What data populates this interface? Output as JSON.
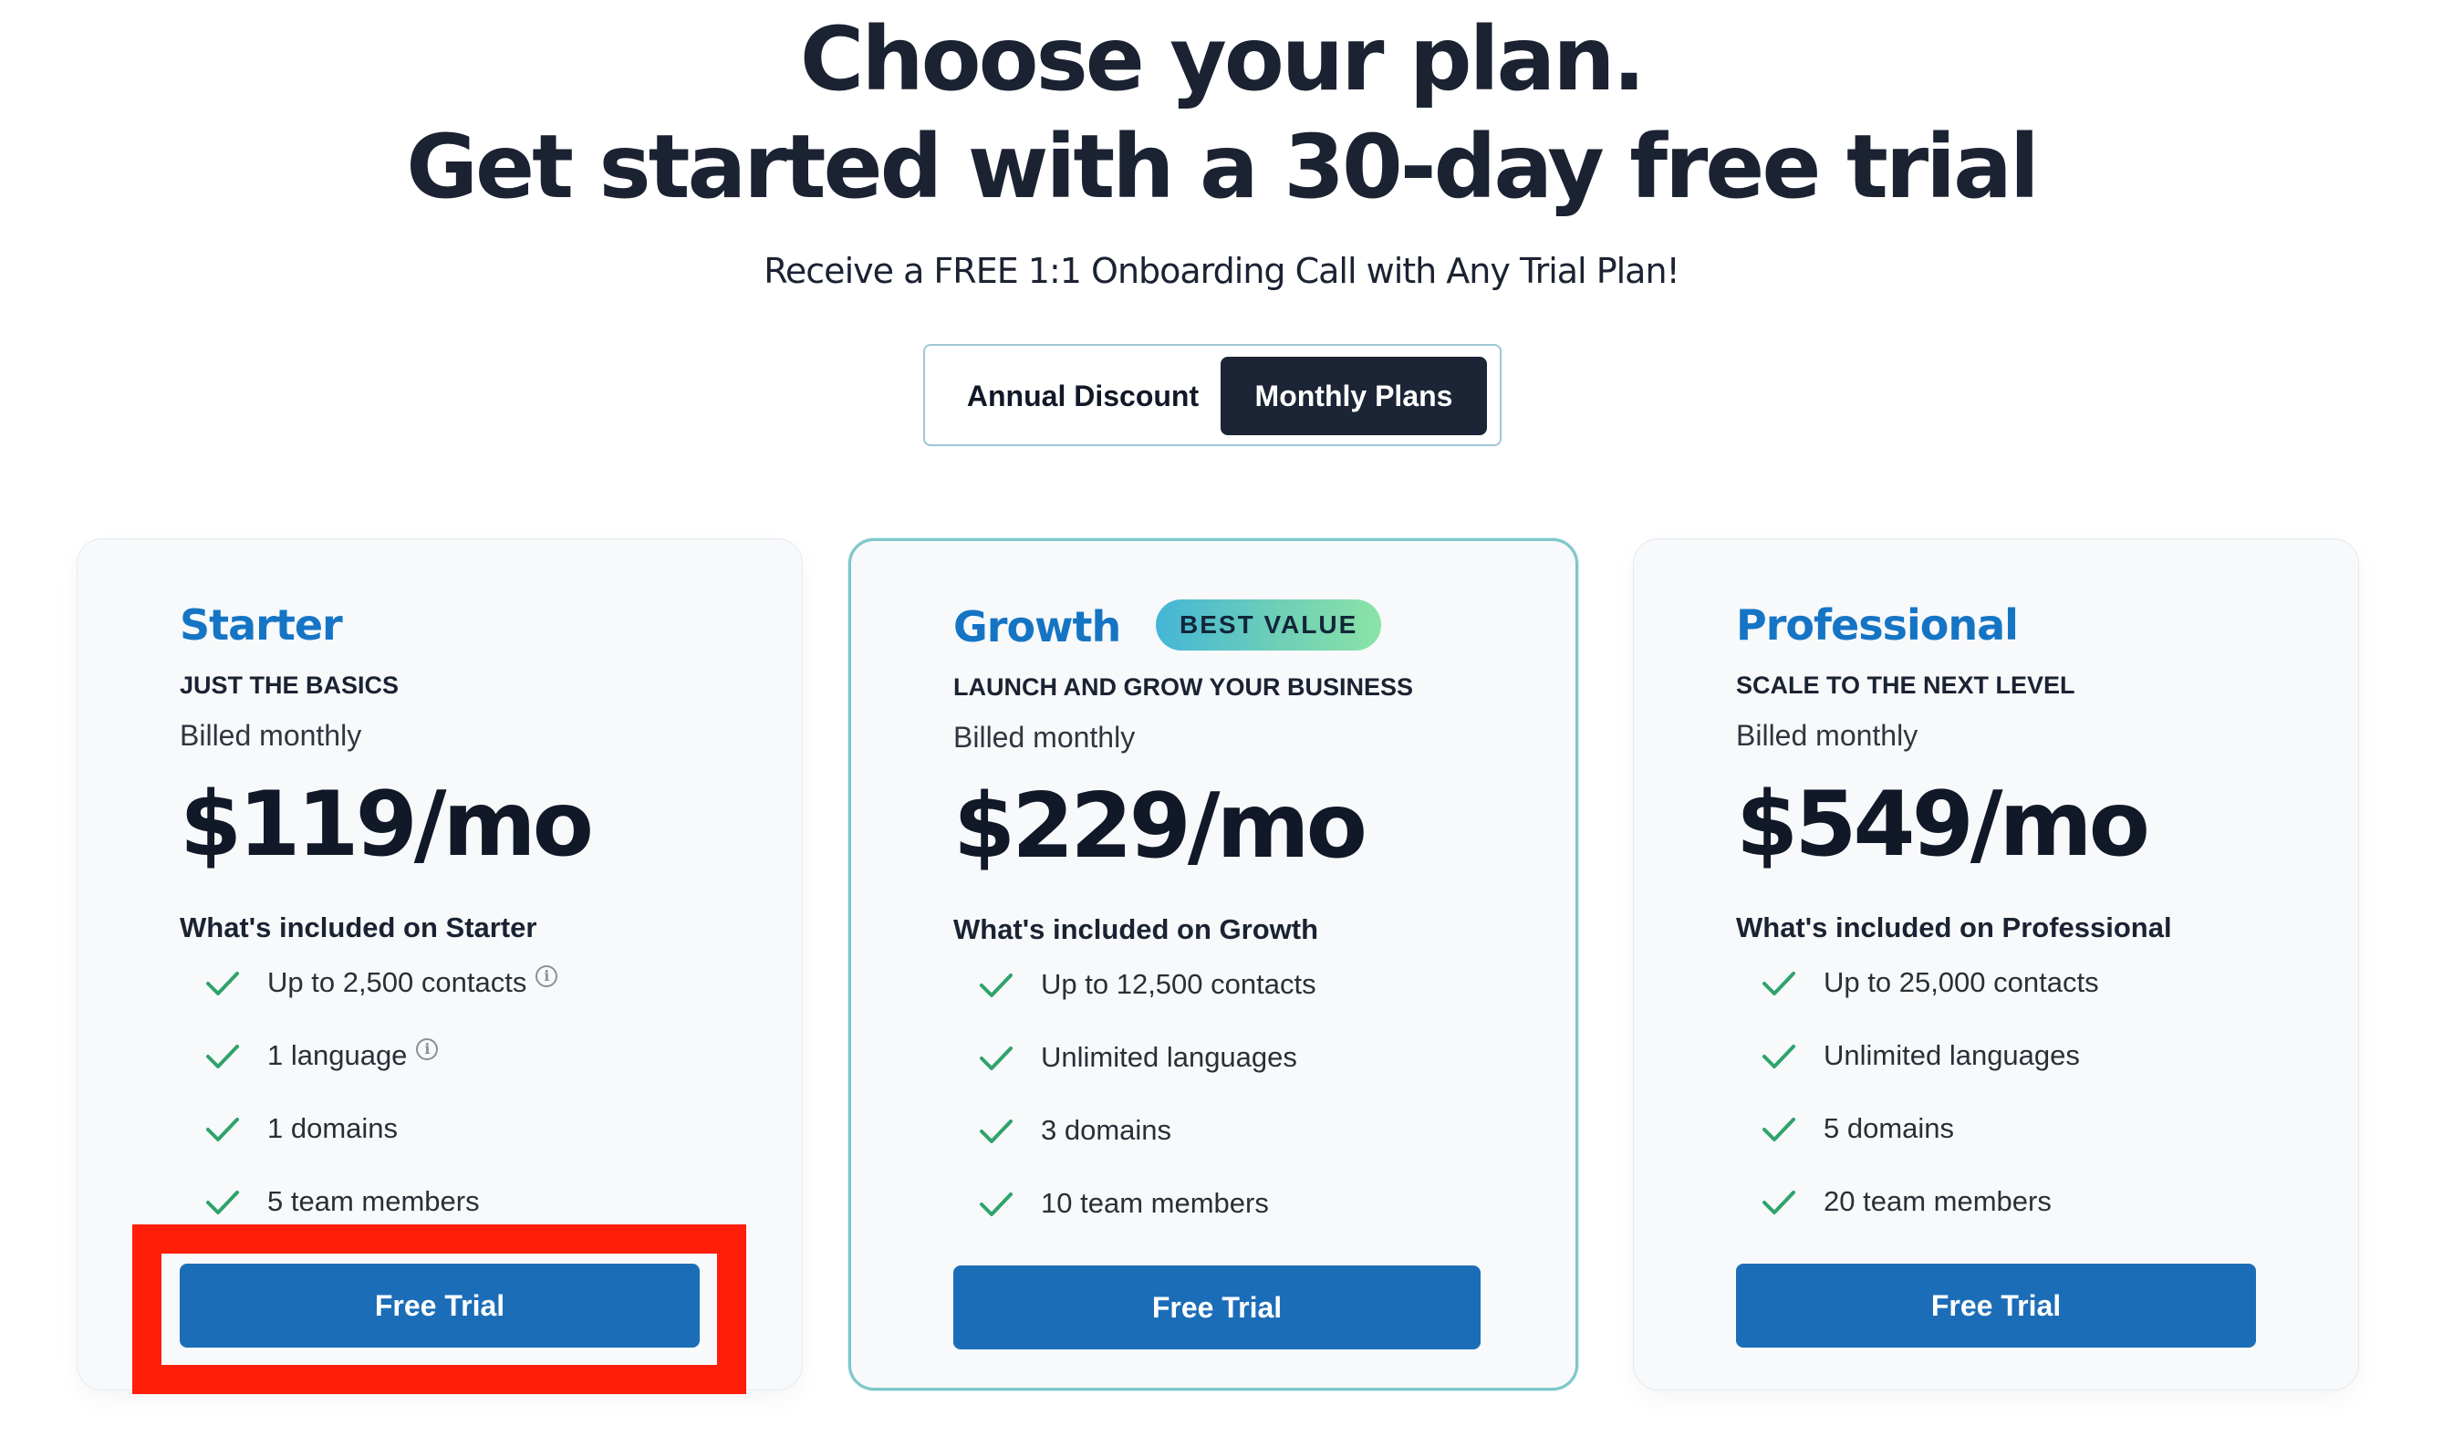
{
  "header": {
    "title_line1": "Choose your plan.",
    "title_line2": "Get started with a 30-day free trial",
    "subtitle": "Receive a FREE 1:1 Onboarding Call with Any Trial Plan!"
  },
  "billing_toggle": {
    "options": [
      "Annual Discount",
      "Monthly Plans"
    ],
    "selected": "Monthly Plans"
  },
  "plans": [
    {
      "name": "Starter",
      "tagline": "JUST THE BASICS",
      "billing": "Billed monthly",
      "price": "$119/mo",
      "included_heading": "What's included on Starter",
      "features": [
        {
          "text": "Up to 2,500 contacts",
          "info": true
        },
        {
          "text": "1 language",
          "info": true
        },
        {
          "text": "1 domains",
          "info": false
        },
        {
          "text": "5 team members",
          "info": false
        }
      ],
      "cta": "Free Trial",
      "highlighted": true
    },
    {
      "name": "Growth",
      "badge": "BEST VALUE",
      "tagline": "LAUNCH AND GROW YOUR BUSINESS",
      "billing": "Billed monthly",
      "price": "$229/mo",
      "included_heading": "What's included on Growth",
      "features": [
        {
          "text": "Up to 12,500 contacts",
          "info": false
        },
        {
          "text": "Unlimited languages",
          "info": false
        },
        {
          "text": "3 domains",
          "info": false
        },
        {
          "text": "10 team members",
          "info": false
        }
      ],
      "cta": "Free Trial"
    },
    {
      "name": "Professional",
      "tagline": "SCALE TO THE NEXT LEVEL",
      "billing": "Billed monthly",
      "price": "$549/mo",
      "included_heading": "What's included on Professional",
      "features": [
        {
          "text": "Up to 25,000 contacts",
          "info": false
        },
        {
          "text": "Unlimited languages",
          "info": false
        },
        {
          "text": "5 domains",
          "info": false
        },
        {
          "text": "20 team members",
          "info": false
        }
      ],
      "cta": "Free Trial"
    }
  ],
  "icons": {
    "check": "check-icon",
    "info": "info-icon"
  },
  "colors": {
    "plan_name": "#1575c4",
    "button": "#1c6db8",
    "toggle_selected": "#1b2535",
    "check": "#2fa36b",
    "highlight": "#ff1e0a"
  }
}
